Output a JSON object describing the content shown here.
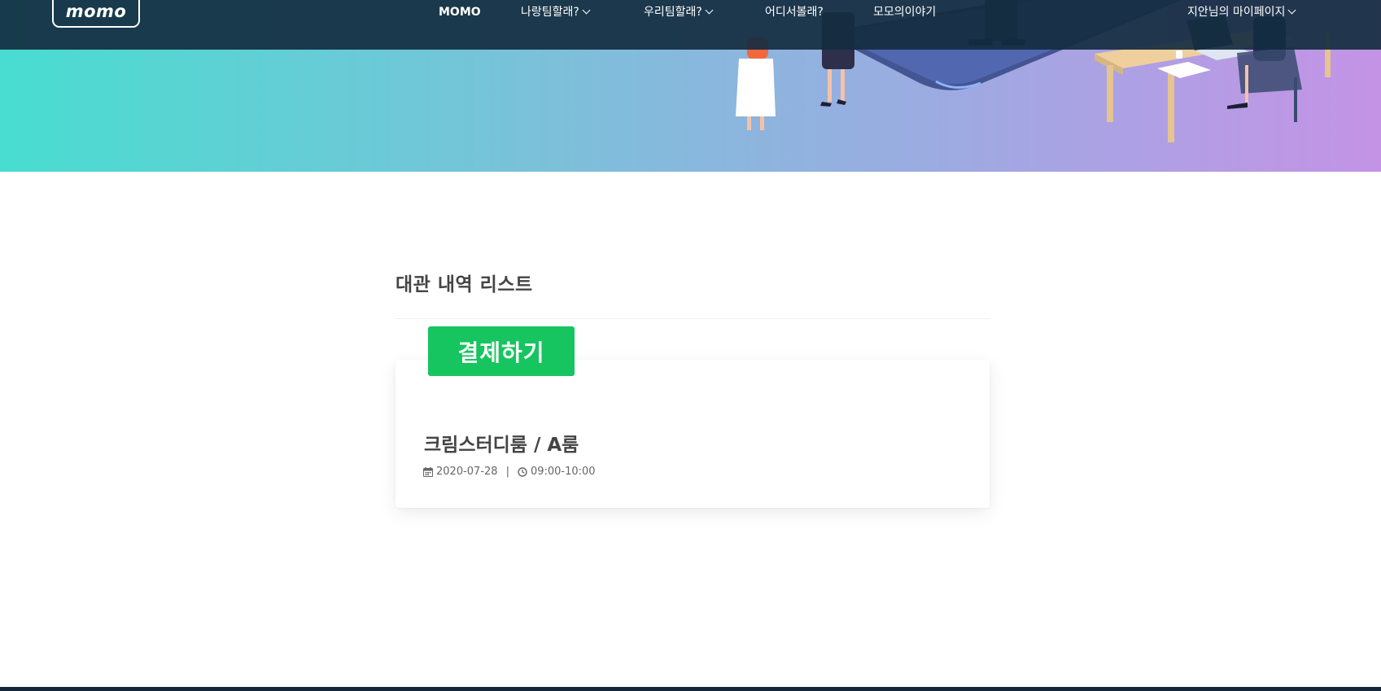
{
  "brand": {
    "logo_text": "momo"
  },
  "nav": {
    "items": [
      {
        "label": "MOMO",
        "has_dropdown": false
      },
      {
        "label": "나랑팀할래?",
        "has_dropdown": true
      },
      {
        "label": "우리팀할래?",
        "has_dropdown": true
      },
      {
        "label": "어디서볼래?",
        "has_dropdown": false
      },
      {
        "label": "모모의이야기",
        "has_dropdown": false
      }
    ],
    "user_menu": {
      "label": "지안님의 마이페이지",
      "has_dropdown": true
    }
  },
  "main": {
    "section_title": "대관 내역 리스트",
    "pay_button_label": "결제하기",
    "booking": {
      "room": "크림스터디룸 / A룸",
      "date": "2020-07-28",
      "separator": "|",
      "time": "09:00-10:00"
    }
  },
  "colors": {
    "navbar": "#132c40",
    "gradient_start": "#48ddd0",
    "gradient_end": "#c493e6",
    "pay_button": "#16c55f",
    "footer": "#16263a"
  },
  "icons": {
    "date": "calendar-icon",
    "time": "clock-icon",
    "dropdown": "chevron-down-icon"
  }
}
